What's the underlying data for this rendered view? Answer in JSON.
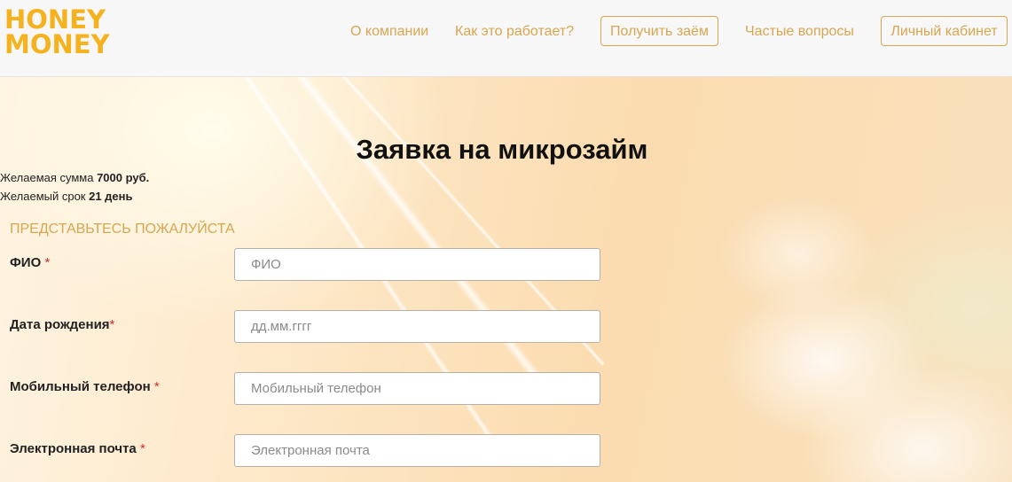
{
  "logo": {
    "line1": "HONEY",
    "line2": "MONEY",
    "color": "#f5b21e"
  },
  "nav": {
    "about": "О компании",
    "how_it_works": "Как это работает?",
    "get_loan": "Получить заём",
    "faq": "Частые вопросы",
    "cabinet": "Личный кабинет",
    "accent_color": "#d7a651"
  },
  "form": {
    "title": "Заявка на микрозайм",
    "amount_prefix": "Желаемая сумма ",
    "amount_value": "7000 руб.",
    "term_prefix": "Желаемый срок ",
    "term_value": "21 день",
    "section_heading": "ПРЕДСТАВЬТЕСЬ ПОЖАЛУЙСТА",
    "required_mark": "*",
    "fields": [
      {
        "label": "ФИО",
        "placeholder": "ФИО",
        "value": ""
      },
      {
        "label": "Дата рождения",
        "placeholder": "дд.мм.гггг",
        "value": ""
      },
      {
        "label": "Мобильный телефон",
        "placeholder": "Мобильный телефон",
        "value": ""
      },
      {
        "label": "Электронная почта",
        "placeholder": "Электронная почта",
        "value": ""
      }
    ]
  }
}
